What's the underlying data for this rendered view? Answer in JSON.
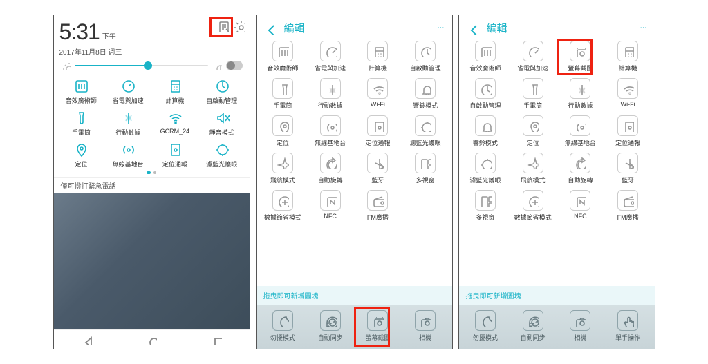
{
  "panel1": {
    "clock": "5:31",
    "ampm": "下午",
    "date": "2017年11月8日 週三",
    "tiles": [
      {
        "label": "音效魔術師",
        "icon": "equalizer"
      },
      {
        "label": "省電與加速",
        "icon": "gauge"
      },
      {
        "label": "計算機",
        "icon": "calculator"
      },
      {
        "label": "自啟動管理",
        "icon": "autostart"
      },
      {
        "label": "手電筒",
        "icon": "flashlight"
      },
      {
        "label": "行動數據",
        "icon": "mobiledata"
      },
      {
        "label": "GCRM_24",
        "icon": "wifi"
      },
      {
        "label": "靜音模式",
        "icon": "mute"
      },
      {
        "label": "定位",
        "icon": "location"
      },
      {
        "label": "無線基地台",
        "icon": "hotspot"
      },
      {
        "label": "定位通報",
        "icon": "locreport"
      },
      {
        "label": "濾藍光護眼",
        "icon": "bluelight"
      }
    ],
    "brightness_pct": 55,
    "emergency": "僅可撥打緊急電話"
  },
  "panel2": {
    "title": "編輯",
    "hint": "拖曳即可新增圖塊",
    "grid": [
      {
        "label": "音效魔術師",
        "icon": "equalizer"
      },
      {
        "label": "省電與加速",
        "icon": "gauge"
      },
      {
        "label": "計算機",
        "icon": "calculator"
      },
      {
        "label": "自啟動管理",
        "icon": "autostart"
      },
      {
        "label": "手電筒",
        "icon": "flashlight"
      },
      {
        "label": "行動數據",
        "icon": "mobiledata"
      },
      {
        "label": "Wi-Fi",
        "icon": "wifi"
      },
      {
        "label": "響鈴模式",
        "icon": "bell"
      },
      {
        "label": "定位",
        "icon": "location"
      },
      {
        "label": "無線基地台",
        "icon": "hotspot"
      },
      {
        "label": "定位通報",
        "icon": "locreport"
      },
      {
        "label": "濾藍光護眼",
        "icon": "bluelight"
      },
      {
        "label": "飛航模式",
        "icon": "airplane"
      },
      {
        "label": "自動旋轉",
        "icon": "rotate"
      },
      {
        "label": "藍牙",
        "icon": "bluetooth"
      },
      {
        "label": "多視窗",
        "icon": "multiwindow"
      },
      {
        "label": "數據節省模式",
        "icon": "datasaver"
      },
      {
        "label": "NFC",
        "icon": "nfc"
      },
      {
        "label": "FM廣播",
        "icon": "radio"
      }
    ],
    "tray": [
      {
        "label": "勿擾模式",
        "icon": "dnd"
      },
      {
        "label": "自動同步",
        "icon": "sync"
      },
      {
        "label": "螢幕截圖",
        "icon": "screenshot"
      },
      {
        "label": "相機",
        "icon": "camera"
      }
    ]
  },
  "panel3": {
    "title": "編輯",
    "hint": "拖曳即可新增圖塊",
    "grid": [
      {
        "label": "音效魔術師",
        "icon": "equalizer"
      },
      {
        "label": "省電與加速",
        "icon": "gauge"
      },
      {
        "label": "螢幕截圖",
        "icon": "screenshot"
      },
      {
        "label": "計算機",
        "icon": "calculator"
      },
      {
        "label": "自啟動管理",
        "icon": "autostart"
      },
      {
        "label": "手電筒",
        "icon": "flashlight"
      },
      {
        "label": "行動數據",
        "icon": "mobiledata"
      },
      {
        "label": "Wi-Fi",
        "icon": "wifi"
      },
      {
        "label": "響鈴模式",
        "icon": "bell"
      },
      {
        "label": "定位",
        "icon": "location"
      },
      {
        "label": "無線基地台",
        "icon": "hotspot"
      },
      {
        "label": "定位通報",
        "icon": "locreport"
      },
      {
        "label": "濾藍光護眼",
        "icon": "bluelight"
      },
      {
        "label": "飛航模式",
        "icon": "airplane"
      },
      {
        "label": "自動旋轉",
        "icon": "rotate"
      },
      {
        "label": "藍牙",
        "icon": "bluetooth"
      },
      {
        "label": "多視窗",
        "icon": "multiwindow"
      },
      {
        "label": "數據節省模式",
        "icon": "datasaver"
      },
      {
        "label": "NFC",
        "icon": "nfc"
      },
      {
        "label": "FM廣播",
        "icon": "radio"
      }
    ],
    "tray": [
      {
        "label": "勿擾模式",
        "icon": "dnd"
      },
      {
        "label": "自動同步",
        "icon": "sync"
      },
      {
        "label": "相機",
        "icon": "camera"
      },
      {
        "label": "單手操作",
        "icon": "onehand"
      }
    ]
  },
  "highlights": {
    "p1_edit_icon": true,
    "p2_tray_screenshot": true,
    "p3_grid_screenshot": true
  }
}
